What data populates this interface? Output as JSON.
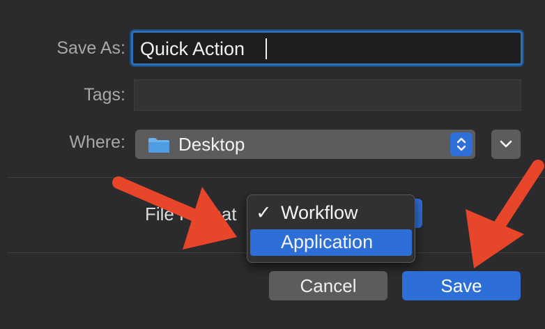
{
  "dialog": {
    "save_as_label": "Save As:",
    "save_as_value": "Quick Action",
    "tags_label": "Tags:",
    "where_label": "Where:",
    "where_value": "Desktop",
    "format_label": "File Format",
    "format_menu": {
      "items": [
        "Workflow",
        "Application"
      ],
      "checked": "Workflow",
      "highlighted": "Application",
      "check_glyph": "✓"
    },
    "cancel_label": "Cancel",
    "save_label": "Save"
  },
  "colors": {
    "accent": "#2d6fd6",
    "annotation_arrow": "#e8462a",
    "background": "#2b2b2d"
  },
  "icons": {
    "folder": "folder-icon",
    "stepper": "chevron-up-down-icon",
    "expand": "chevron-down-icon",
    "check": "checkmark-icon"
  }
}
